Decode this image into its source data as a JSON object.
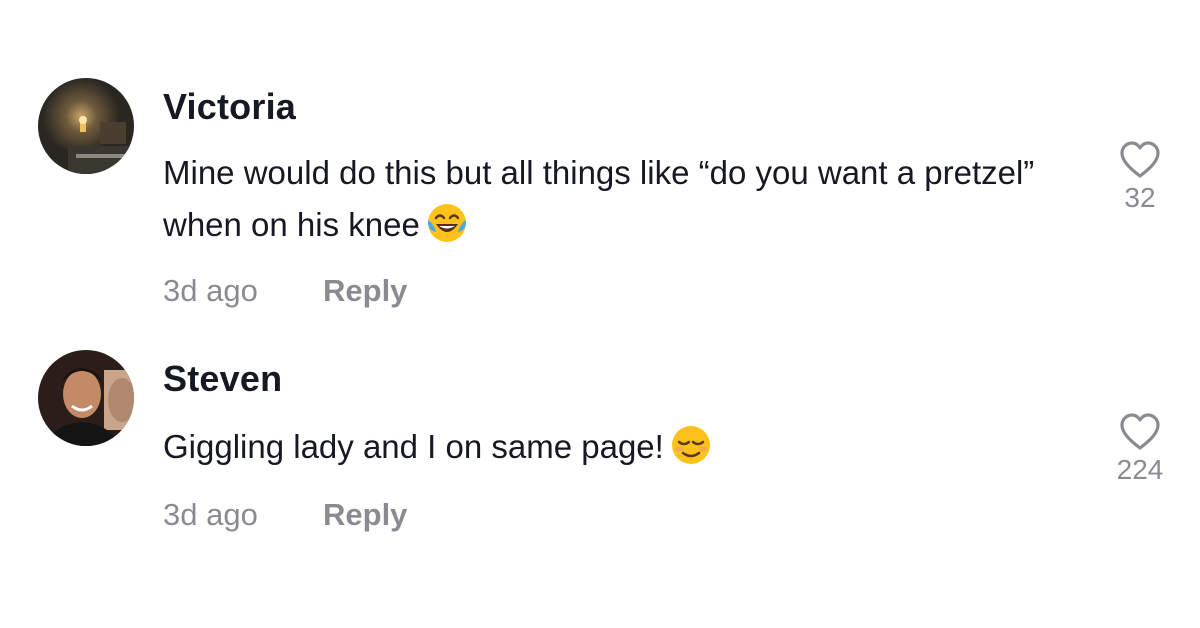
{
  "comments": [
    {
      "username": "Victoria",
      "text": "Mine would do this but all things like “do you want a pretzel” when on his knee",
      "emoji": "face-with-tears-of-joy",
      "time": "3d ago",
      "reply_label": "Reply",
      "likes": "32",
      "avatar": "candle-room-photo"
    },
    {
      "username": "Steven",
      "text": "Giggling lady and I on same page!",
      "emoji": "relieved-face",
      "time": "3d ago",
      "reply_label": "Reply",
      "likes": "224",
      "avatar": "man-portrait-photo"
    }
  ],
  "colors": {
    "primary_text": "#161823",
    "secondary_text": "#8a8b91",
    "background": "#ffffff"
  }
}
